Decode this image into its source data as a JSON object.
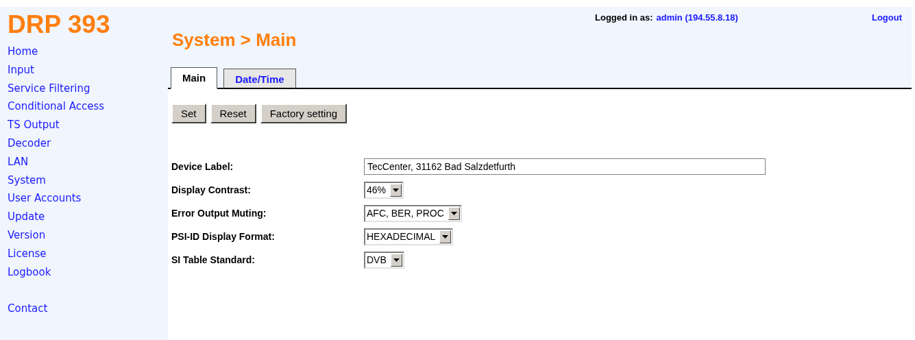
{
  "sidebar": {
    "logo": "DRP 393",
    "items": [
      "Home",
      "Input",
      "Service Filtering",
      "Conditional Access",
      "TS Output",
      "Decoder",
      "LAN",
      "System",
      "User Accounts",
      "Update",
      "Version",
      "License",
      "Logbook"
    ],
    "footer_items": [
      "Contact"
    ]
  },
  "header": {
    "logged_in_label": "Logged in as:",
    "user": "admin (194.55.8.18)",
    "logout": "Logout",
    "title": "System > Main"
  },
  "tabs": [
    {
      "label": "Main",
      "selected": true
    },
    {
      "label": "Date/Time",
      "selected": false
    }
  ],
  "buttons": [
    "Set",
    "Reset",
    "Factory setting"
  ],
  "form": [
    {
      "label": "Device Label:",
      "kind": "text",
      "value": "TecCenter, 31162 Bad Salzdetfurth"
    },
    {
      "label": "Display Contrast:",
      "kind": "select",
      "value": "46%"
    },
    {
      "label": "Error Output Muting:",
      "kind": "select",
      "value": "AFC, BER, PROC"
    },
    {
      "label": "PSI-ID Display Format:",
      "kind": "select",
      "value": "HEXADECIMAL"
    },
    {
      "label": "SI Table Standard:",
      "kind": "select",
      "value": "DVB"
    }
  ]
}
